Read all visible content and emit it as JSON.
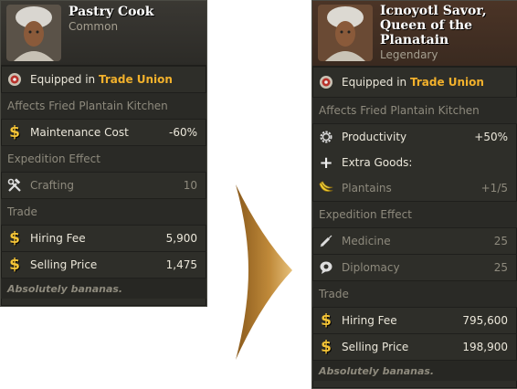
{
  "left_card": {
    "name": "Pastry Cook",
    "rarity": "Common",
    "equipped_prefix": "Equipped in",
    "equipped_place": "Trade Union",
    "affects": "Affects Fried Plantain Kitchen",
    "maintenance_label": "Maintenance Cost",
    "maintenance_value": "-60%",
    "expedition_header": "Expedition Effect",
    "crafting_label": "Crafting",
    "crafting_value": "10",
    "trade_header": "Trade",
    "hiring_label": "Hiring Fee",
    "hiring_value": "5,900",
    "selling_label": "Selling Price",
    "selling_value": "1,475",
    "flavor": "Absolutely bananas."
  },
  "right_card": {
    "name": "Icnoyotl Savor, Queen of the Planatain",
    "rarity": "Legendary",
    "equipped_prefix": "Equipped in",
    "equipped_place": "Trade Union",
    "affects": "Affects Fried Plantain Kitchen",
    "productivity_label": "Productivity",
    "productivity_value": "+50%",
    "extra_label": "Extra Goods:",
    "plantains_label": "Plantains",
    "plantains_value": "+1/5",
    "expedition_header": "Expedition Effect",
    "medicine_label": "Medicine",
    "medicine_value": "25",
    "diplomacy_label": "Diplomacy",
    "diplomacy_value": "25",
    "trade_header": "Trade",
    "hiring_label": "Hiring Fee",
    "hiring_value": "795,600",
    "selling_label": "Selling Price",
    "selling_value": "198,900",
    "flavor": "Absolutely bananas."
  },
  "colors": {
    "card_bg": "#2e2e29",
    "highlight": "#f2b12c",
    "coin": "#f4c437",
    "legendary_header": "#4b3426",
    "arrow": "#b07a2a"
  },
  "icons": {
    "guild": "guild-emblem-icon",
    "coin": "dollar-icon",
    "crafting": "hammer-wrench-icon",
    "productivity": "gear-icon",
    "extra": "plus-icon",
    "plantain": "banana-icon",
    "medicine": "syringe-icon",
    "diplomacy": "speech-bubble-icon"
  }
}
